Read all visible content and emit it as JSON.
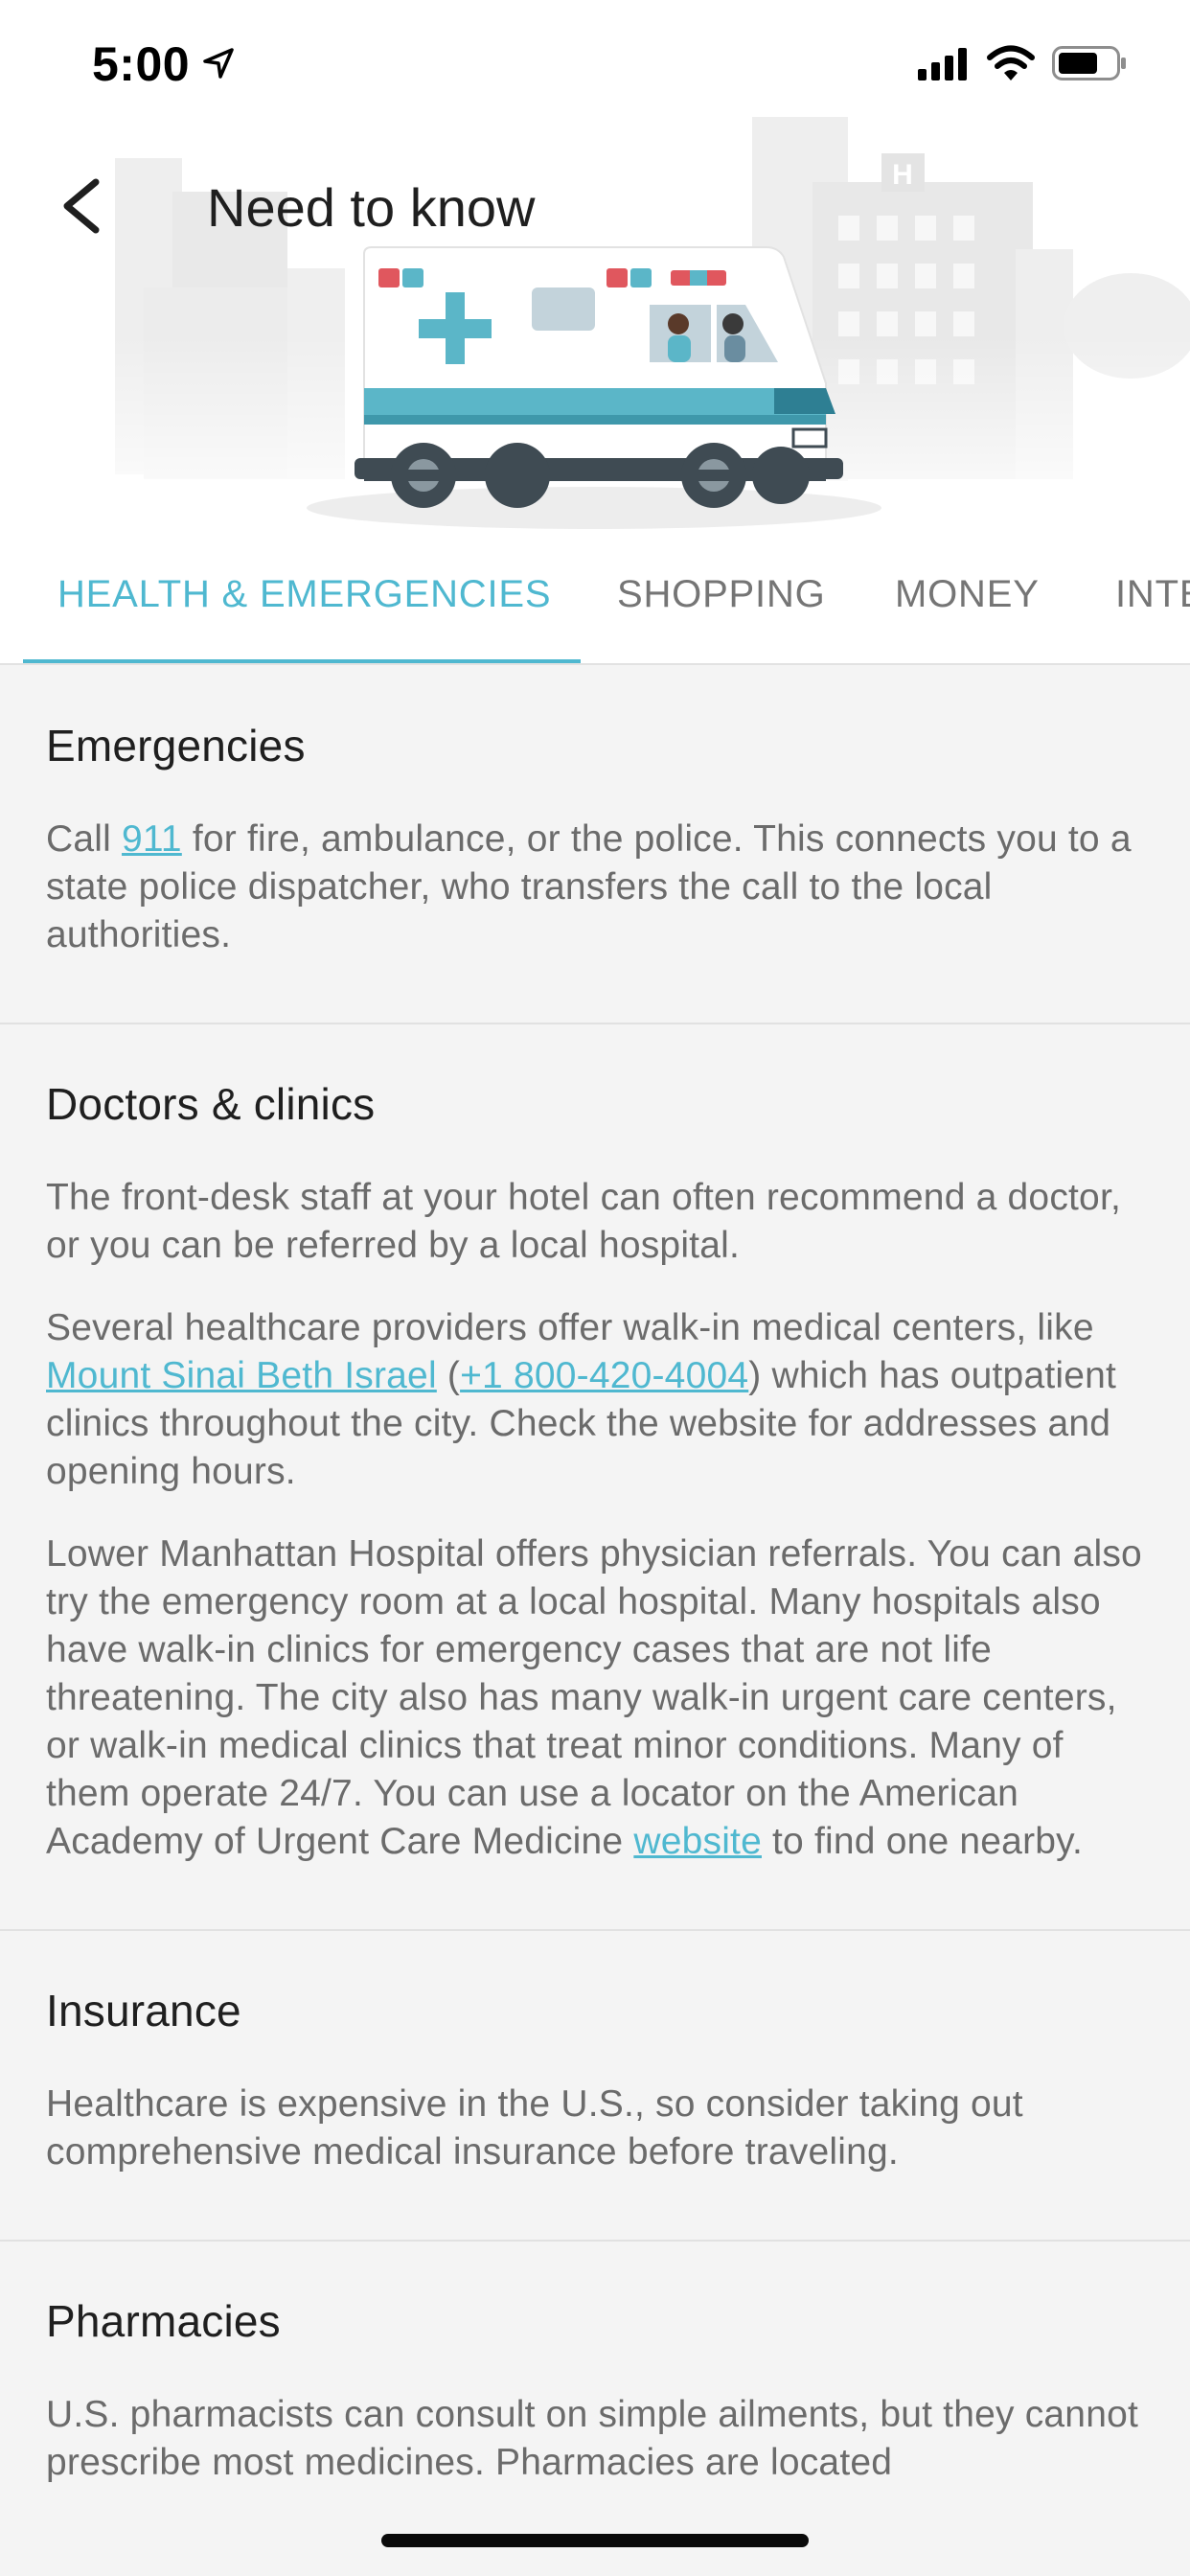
{
  "status_bar": {
    "time": "5:00"
  },
  "header": {
    "title": "Need to know"
  },
  "tabs": [
    {
      "label": "HEALTH & EMERGENCIES",
      "active": true
    },
    {
      "label": "SHOPPING",
      "active": false
    },
    {
      "label": "MONEY",
      "active": false
    },
    {
      "label": "INTERNET",
      "active": false
    }
  ],
  "sections": {
    "emergencies": {
      "title": "Emergencies",
      "p1": {
        "pre": "Call ",
        "link": "911",
        "post": " for fire, ambulance, or the police. This connects you to a state police dispatcher, who transfers the call to the local authorities."
      }
    },
    "doctors": {
      "title": "Doctors & clinics",
      "p1": "The front-desk staff at your hotel can often recommend a doctor, or you can be referred by a local hospital.",
      "p2": {
        "pre": "Several healthcare providers offer walk-in medical centers, like ",
        "link1": "Mount Sinai Beth Israel",
        "mid": " (",
        "link2": "+1 800-420-4004",
        "post": ") which has outpatient clinics throughout the city. Check the website for addresses and opening hours."
      },
      "p3": {
        "pre": "Lower Manhattan Hospital offers physician referrals. You can also try the emergency room at a local hospital. Many hospitals also have walk-in clinics for emergency cases that are not life threatening. The city also has many walk-in urgent care centers, or walk-in medical clinics that treat minor conditions. Many of them operate 24/7. You can use a locator on the American Academy of Urgent Care Medicine ",
        "link": "website",
        "post": " to find one nearby."
      }
    },
    "insurance": {
      "title": "Insurance",
      "p1": "Healthcare is expensive in the U.S., so consider taking out comprehensive medical insurance before traveling."
    },
    "pharmacies": {
      "title": "Pharmacies",
      "p1": "U.S. pharmacists can consult on simple ailments, but they cannot prescribe most medicines. Pharmacies are located"
    }
  },
  "colors": {
    "accent": "#4fb8d0",
    "body_text": "#6b6b6b",
    "heading": "#1f1f1f",
    "background": "#f4f4f4"
  },
  "icons": [
    "location-arrow-icon",
    "cellular-signal-icon",
    "wifi-icon",
    "battery-icon",
    "back-arrow-icon"
  ]
}
